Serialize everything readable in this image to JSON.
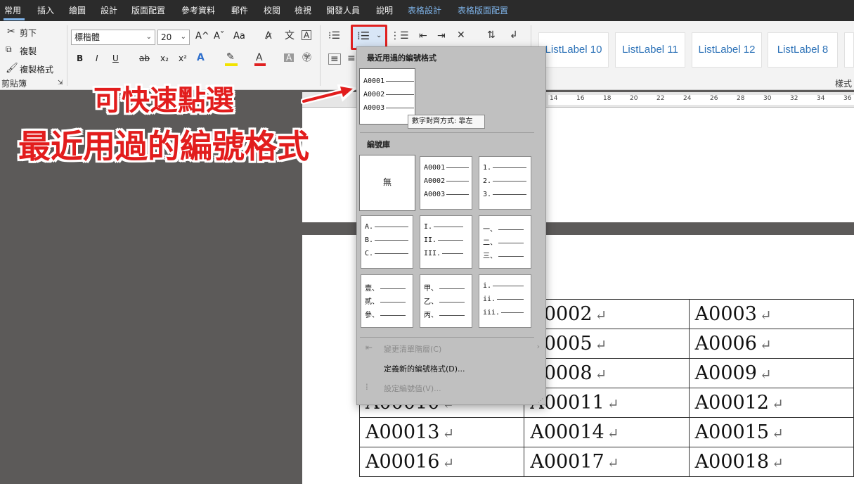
{
  "menubar": {
    "tabs": [
      "常用",
      "插入",
      "繪圖",
      "設計",
      "版面配置",
      "參考資料",
      "郵件",
      "校閱",
      "檢視",
      "開發人員",
      "說明"
    ],
    "context_tabs": [
      "表格設計",
      "表格版面配置"
    ],
    "active_tab": "常用"
  },
  "clipboard": {
    "cut": "剪下",
    "copy": "複製",
    "format_painter": "複製格式",
    "group_label": "剪貼簿"
  },
  "font": {
    "name": "標楷體",
    "size": "20",
    "bold": "B",
    "italic": "I",
    "underline": "U",
    "strike": "ab",
    "subscript": "x₂",
    "superscript": "x²",
    "grow": "A^",
    "shrink": "Aˇ",
    "case": "Aa",
    "highlight_color": "#f2e300",
    "font_color": "#e02020"
  },
  "styles": {
    "items": [
      "ListLabel 10",
      "ListLabel 11",
      "ListLabel 12",
      "ListLabel 8"
    ],
    "group_label": "樣式"
  },
  "ruler": {
    "ticks": [
      "14",
      "16",
      "18",
      "20",
      "22",
      "24",
      "26",
      "28",
      "30",
      "32",
      "34",
      "36"
    ]
  },
  "annotation": {
    "line1": "可快速點選",
    "line2": "最近用過的編號格式"
  },
  "dropdown": {
    "recent_heading": "最近用過的編號格式",
    "recent_tile": [
      "A0001",
      "A0002",
      "A0003"
    ],
    "tooltip": "數字對齊方式: 靠左",
    "library_heading": "編號庫",
    "none_label": "無",
    "library": [
      [
        "A0001",
        "A0002",
        "A0003"
      ],
      [
        "1.",
        "2.",
        "3."
      ],
      [
        "A.",
        "B.",
        "C."
      ],
      [
        "I.",
        "II.",
        "III."
      ],
      [
        "一、",
        "二、",
        "三、"
      ],
      [
        "壹、",
        "貳、",
        "參、"
      ],
      [
        "甲、",
        "乙、",
        "丙、"
      ],
      [
        "i.",
        "ii.",
        "iii."
      ]
    ],
    "cmd_change_level": "變更清單階層(C)",
    "cmd_define_new": "定義新的編號格式(D)...",
    "cmd_set_value": "設定編號值(V)..."
  },
  "table": {
    "rows": [
      [
        "",
        "A0002",
        "A0003"
      ],
      [
        "",
        "A0005",
        "A0006"
      ],
      [
        "",
        "A0008",
        "A0009"
      ],
      [
        "A00010",
        "A00011",
        "A00012"
      ],
      [
        "A00013",
        "A00014",
        "A00015"
      ],
      [
        "A00016",
        "A00017",
        "A00018"
      ]
    ],
    "return_mark": "↵"
  }
}
